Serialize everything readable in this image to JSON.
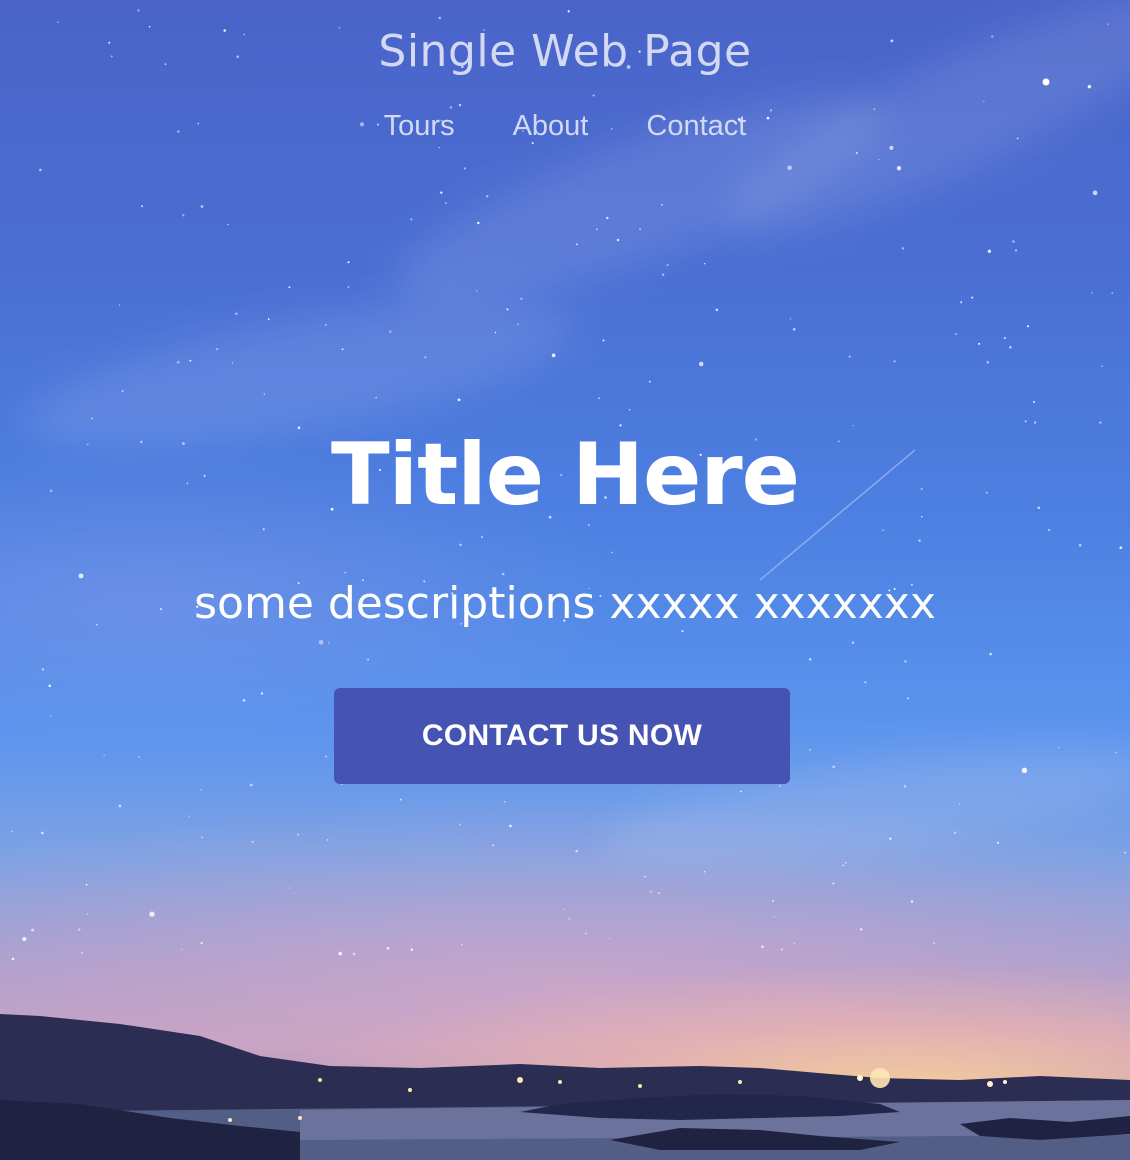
{
  "header": {
    "site_title": "Single Web Page",
    "nav": [
      {
        "label": "Tours"
      },
      {
        "label": "About"
      },
      {
        "label": "Contact"
      }
    ]
  },
  "hero": {
    "title": "Title Here",
    "description": "some descriptions xxxxx xxxxxxx",
    "cta_label": "CONTACT US NOW",
    "background_image": "night-sky-over-lake-landscape"
  },
  "colors": {
    "button": "#4553b3",
    "nav_text": "#d4d9f3",
    "hero_text": "#ffffff"
  }
}
